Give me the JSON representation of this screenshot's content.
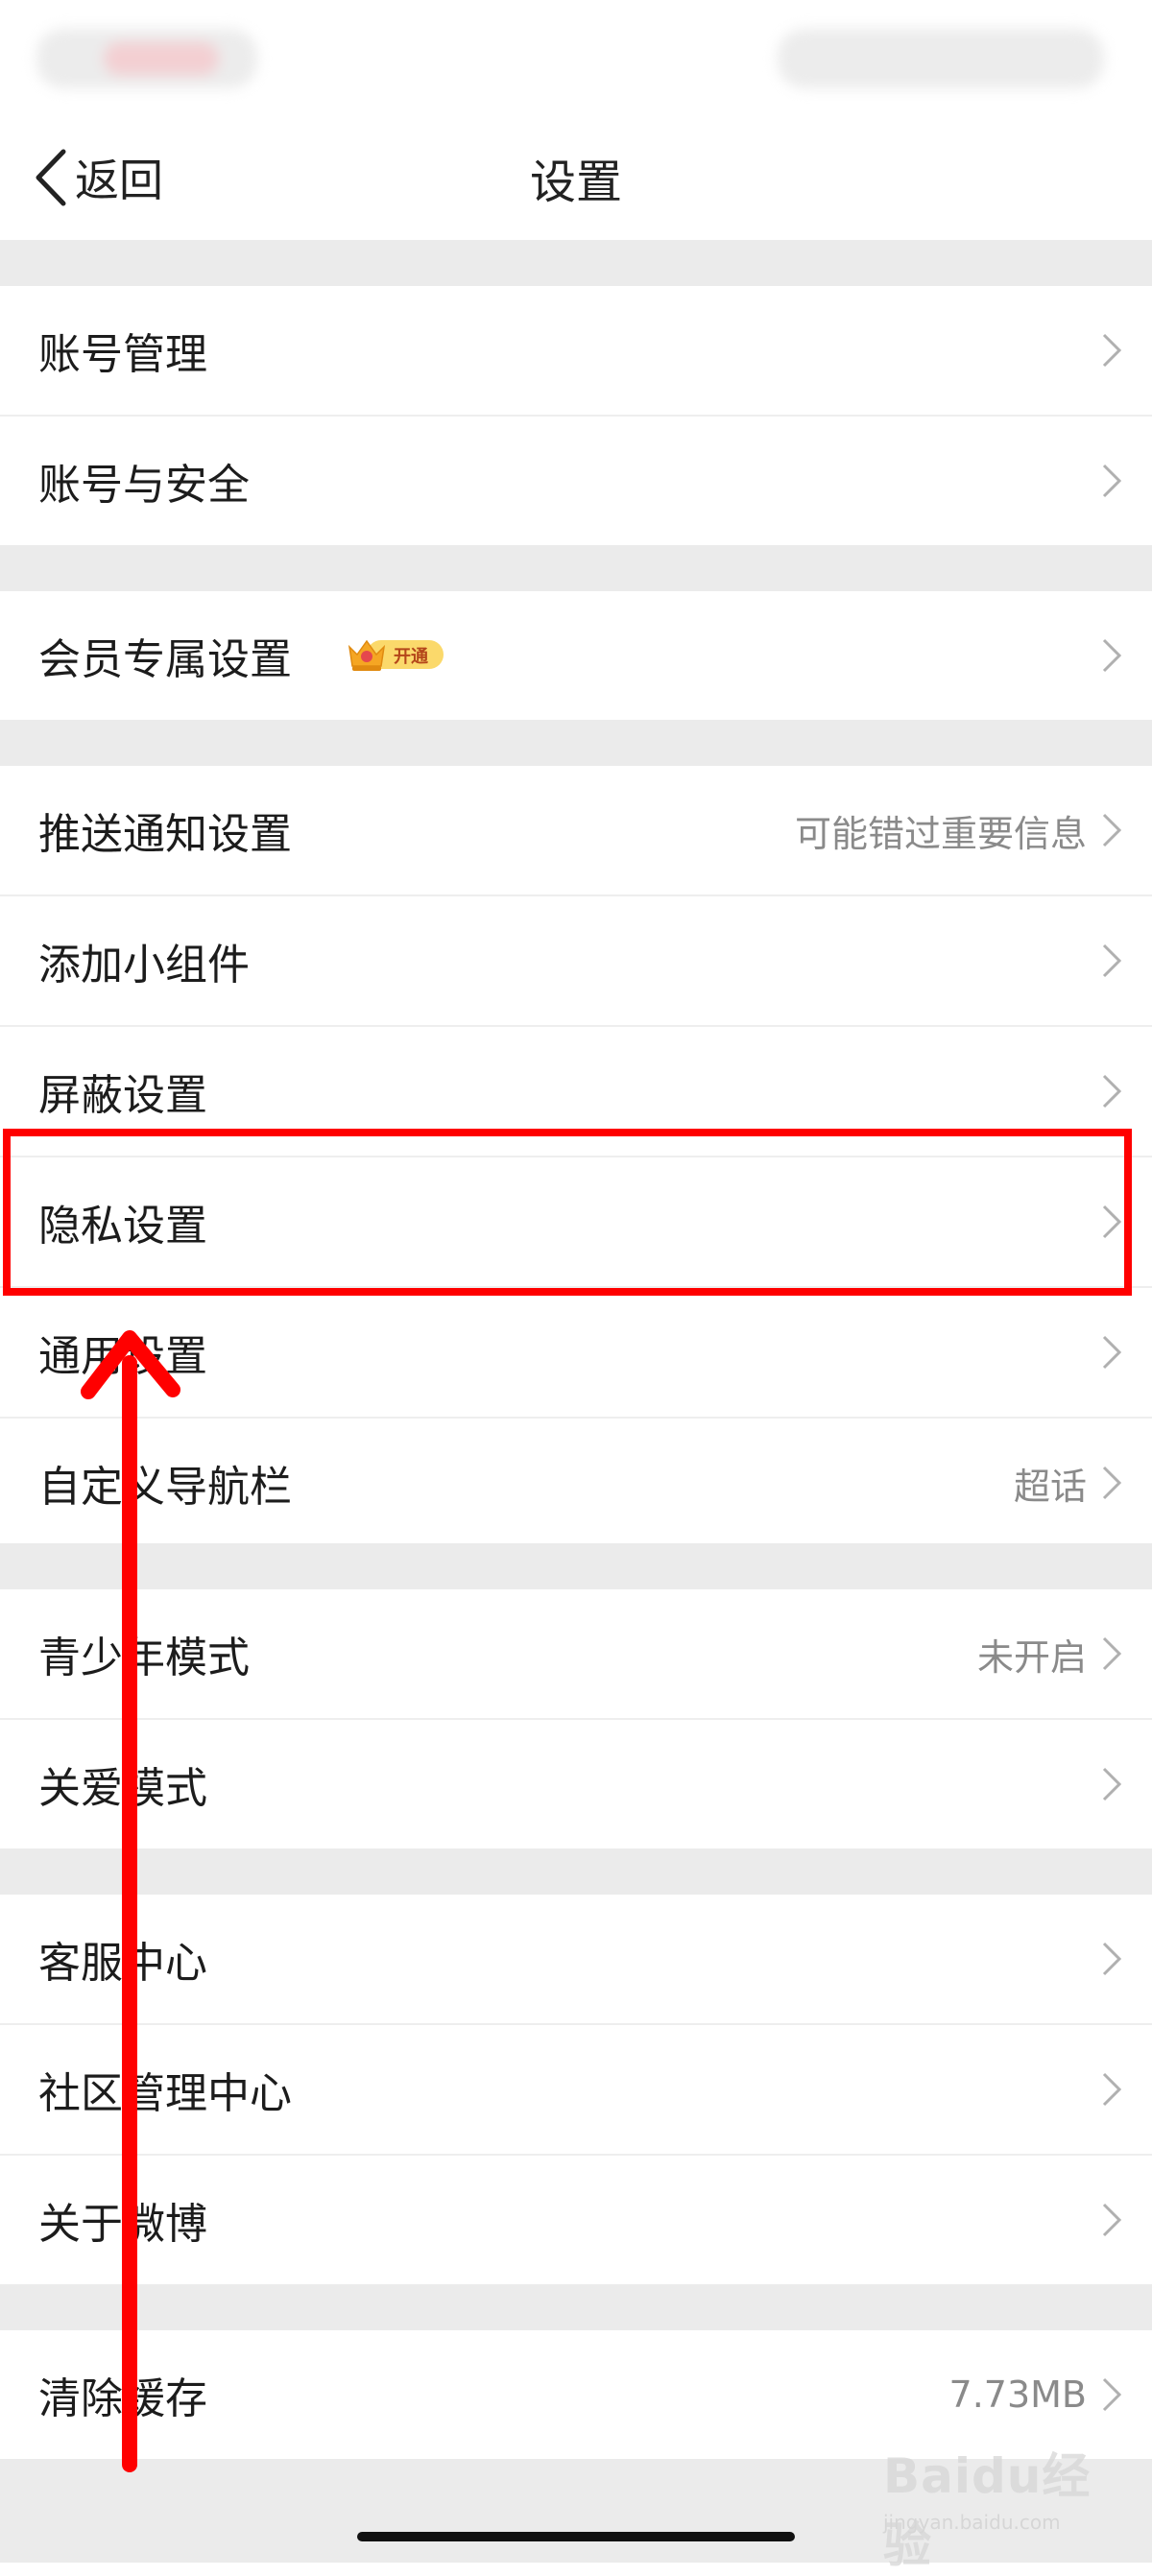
{
  "nav": {
    "back_label": "返回",
    "title": "设置"
  },
  "section_account": [
    {
      "label": "账号管理"
    },
    {
      "label": "账号与安全"
    }
  ],
  "section_vip": [
    {
      "label": "会员专属设置",
      "badge": "开通"
    }
  ],
  "section_general": [
    {
      "label": "推送通知设置",
      "value": "可能错过重要信息"
    },
    {
      "label": "添加小组件"
    },
    {
      "label": "屏蔽设置"
    },
    {
      "label": "隐私设置"
    },
    {
      "label": "通用设置"
    },
    {
      "label": "自定义导航栏",
      "value": "超话"
    }
  ],
  "section_mode": [
    {
      "label": "青少年模式",
      "value": "未开启"
    },
    {
      "label": "关爱模式"
    }
  ],
  "section_help": [
    {
      "label": "客服中心"
    },
    {
      "label": "社区管理中心"
    },
    {
      "label": "关于微博"
    }
  ],
  "section_cache": [
    {
      "label": "清除缓存",
      "value": "7.73MB"
    }
  ],
  "watermark": {
    "logo": "Baidu经验",
    "url": "jingyan.baidu.com"
  },
  "colors": {
    "highlight": "#ff0000",
    "arrow": "#ff0000",
    "section_gap": "#ebebeb"
  },
  "icons": {
    "back": "chevron-left-icon",
    "row_arrow": "chevron-right-icon",
    "vip": "crown-icon"
  }
}
